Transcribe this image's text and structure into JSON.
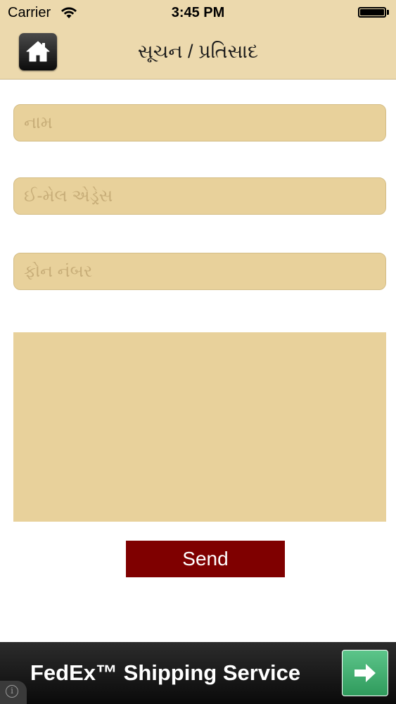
{
  "status_bar": {
    "carrier": "Carrier",
    "time": "3:45 PM"
  },
  "nav": {
    "title": "સૂચન / પ્રતિસાદ",
    "home_icon": "home-icon"
  },
  "form": {
    "name_placeholder": "નામ",
    "email_placeholder": "ઈ-મેલ એડ્રેસ",
    "phone_placeholder": "ફોન નંબર",
    "message_value": "",
    "send_label": "Send"
  },
  "ad": {
    "text": "FedEx™ Shipping Service",
    "arrow_icon": "arrow-right-icon",
    "info_icon": "info-icon"
  },
  "colors": {
    "header_bg": "#ecd9ad",
    "field_bg": "#e8d19b",
    "send_bg": "#7f0000",
    "ad_button": "#3fae6c"
  }
}
